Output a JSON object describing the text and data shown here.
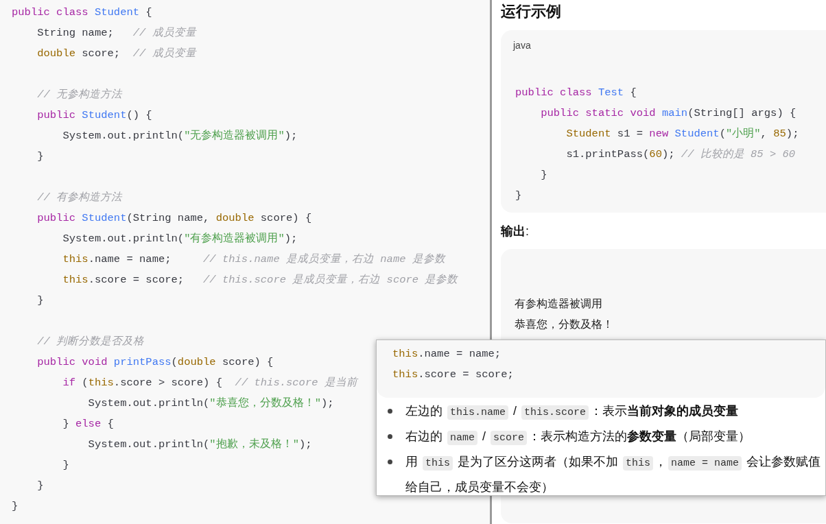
{
  "source_code": {
    "lines": [
      {
        "kind": "code",
        "tokens": [
          {
            "kind": "kw",
            "text": "public class "
          },
          {
            "kind": "cls",
            "text": "Student"
          },
          {
            "kind": "plain",
            "text": " {"
          }
        ]
      },
      {
        "kind": "code",
        "tokens": [
          {
            "kind": "plain",
            "text": "    String name;   "
          },
          {
            "kind": "cmt",
            "text": "// 成员变量"
          }
        ]
      },
      {
        "kind": "code",
        "tokens": [
          {
            "kind": "type",
            "text": "    double"
          },
          {
            "kind": "plain",
            "text": " score;  "
          },
          {
            "kind": "cmt",
            "text": "// 成员变量"
          }
        ]
      },
      {
        "kind": "blank"
      },
      {
        "kind": "code",
        "tokens": [
          {
            "kind": "cmt",
            "text": "    // 无参构造方法"
          }
        ]
      },
      {
        "kind": "code",
        "tokens": [
          {
            "kind": "kw",
            "text": "    public "
          },
          {
            "kind": "cls",
            "text": "Student"
          },
          {
            "kind": "plain",
            "text": "() {"
          }
        ]
      },
      {
        "kind": "code",
        "tokens": [
          {
            "kind": "plain",
            "text": "        System.out.println("
          },
          {
            "kind": "str",
            "text": "\"无参构造器被调用\""
          },
          {
            "kind": "plain",
            "text": ");"
          }
        ]
      },
      {
        "kind": "code",
        "tokens": [
          {
            "kind": "plain",
            "text": "    }"
          }
        ]
      },
      {
        "kind": "blank"
      },
      {
        "kind": "code",
        "tokens": [
          {
            "kind": "cmt",
            "text": "    // 有参构造方法"
          }
        ]
      },
      {
        "kind": "code",
        "tokens": [
          {
            "kind": "kw",
            "text": "    public "
          },
          {
            "kind": "cls",
            "text": "Student"
          },
          {
            "kind": "plain",
            "text": "(String name, "
          },
          {
            "kind": "type",
            "text": "double"
          },
          {
            "kind": "plain",
            "text": " score) {"
          }
        ]
      },
      {
        "kind": "code",
        "tokens": [
          {
            "kind": "plain",
            "text": "        System.out.println("
          },
          {
            "kind": "str",
            "text": "\"有参构造器被调用\""
          },
          {
            "kind": "plain",
            "text": ");"
          }
        ]
      },
      {
        "kind": "code",
        "tokens": [
          {
            "kind": "type",
            "text": "        this"
          },
          {
            "kind": "plain",
            "text": ".name = name;     "
          },
          {
            "kind": "cmt",
            "text": "// this.name 是成员变量，右边 name 是参数"
          }
        ]
      },
      {
        "kind": "code",
        "tokens": [
          {
            "kind": "type",
            "text": "        this"
          },
          {
            "kind": "plain",
            "text": ".score = score;   "
          },
          {
            "kind": "cmt",
            "text": "// this.score 是成员变量，右边 score 是参数"
          }
        ]
      },
      {
        "kind": "code",
        "tokens": [
          {
            "kind": "plain",
            "text": "    }"
          }
        ]
      },
      {
        "kind": "blank"
      },
      {
        "kind": "code",
        "tokens": [
          {
            "kind": "cmt",
            "text": "    // 判断分数是否及格"
          }
        ]
      },
      {
        "kind": "code",
        "tokens": [
          {
            "kind": "kw",
            "text": "    public void "
          },
          {
            "kind": "cls",
            "text": "printPass"
          },
          {
            "kind": "plain",
            "text": "("
          },
          {
            "kind": "type",
            "text": "double"
          },
          {
            "kind": "plain",
            "text": " score) {"
          }
        ]
      },
      {
        "kind": "code",
        "tokens": [
          {
            "kind": "kw",
            "text": "        if"
          },
          {
            "kind": "plain",
            "text": " ("
          },
          {
            "kind": "type",
            "text": "this"
          },
          {
            "kind": "plain",
            "text": ".score > score) {  "
          },
          {
            "kind": "cmt",
            "text": "// this.score 是当前"
          }
        ]
      },
      {
        "kind": "code",
        "tokens": [
          {
            "kind": "plain",
            "text": "            System.out.println("
          },
          {
            "kind": "str",
            "text": "\"恭喜您，分数及格！\""
          },
          {
            "kind": "plain",
            "text": ");"
          }
        ]
      },
      {
        "kind": "code",
        "tokens": [
          {
            "kind": "plain",
            "text": "        } "
          },
          {
            "kind": "kw",
            "text": "else"
          },
          {
            "kind": "plain",
            "text": " {"
          }
        ]
      },
      {
        "kind": "code",
        "tokens": [
          {
            "kind": "plain",
            "text": "            System.out.println("
          },
          {
            "kind": "str",
            "text": "\"抱歉，未及格！\""
          },
          {
            "kind": "plain",
            "text": ");"
          }
        ]
      },
      {
        "kind": "code",
        "tokens": [
          {
            "kind": "plain",
            "text": "        }"
          }
        ]
      },
      {
        "kind": "code",
        "tokens": [
          {
            "kind": "plain",
            "text": "    }"
          }
        ]
      },
      {
        "kind": "code",
        "tokens": [
          {
            "kind": "plain",
            "text": "}"
          }
        ]
      }
    ]
  },
  "answer": {
    "heading": "运行示例",
    "example_code": {
      "language": "java",
      "lines": [
        {
          "kind": "blank"
        },
        {
          "kind": "code",
          "tokens": [
            {
              "kind": "kw",
              "text": "public class "
            },
            {
              "kind": "cls",
              "text": "Test"
            },
            {
              "kind": "plain",
              "text": " {"
            }
          ]
        },
        {
          "kind": "code",
          "tokens": [
            {
              "kind": "kw",
              "text": "    public static void "
            },
            {
              "kind": "cls",
              "text": "main"
            },
            {
              "kind": "plain",
              "text": "(String[] args) {"
            }
          ]
        },
        {
          "kind": "code",
          "tokens": [
            {
              "kind": "type",
              "text": "        Student"
            },
            {
              "kind": "plain",
              "text": " s1 = "
            },
            {
              "kind": "kw",
              "text": "new "
            },
            {
              "kind": "cls",
              "text": "Student"
            },
            {
              "kind": "plain",
              "text": "("
            },
            {
              "kind": "str",
              "text": "\"小明\""
            },
            {
              "kind": "plain",
              "text": ", "
            },
            {
              "kind": "num",
              "text": "85"
            },
            {
              "kind": "plain",
              "text": ");"
            }
          ]
        },
        {
          "kind": "code",
          "tokens": [
            {
              "kind": "plain",
              "text": "        s1.printPass("
            },
            {
              "kind": "num",
              "text": "60"
            },
            {
              "kind": "plain",
              "text": "); "
            },
            {
              "kind": "cmt",
              "text": "// 比较的是 85 > 60"
            }
          ]
        },
        {
          "kind": "code",
          "tokens": [
            {
              "kind": "plain",
              "text": "    }"
            }
          ]
        },
        {
          "kind": "code",
          "tokens": [
            {
              "kind": "plain",
              "text": "}"
            }
          ]
        }
      ]
    },
    "output_label": "**输出**:",
    "output_lines": [
      "有参构造器被调用",
      "恭喜您，分数及格！"
    ]
  },
  "popup": {
    "code_lines": [
      {
        "kind": "code",
        "tokens": [
          {
            "kind": "type",
            "text": "this"
          },
          {
            "kind": "plain",
            "text": ".name = name;"
          }
        ]
      },
      {
        "kind": "code",
        "tokens": [
          {
            "kind": "type",
            "text": "this"
          },
          {
            "kind": "plain",
            "text": ".score = score;"
          }
        ]
      }
    ],
    "bullets": [
      [
        {
          "kind": "text",
          "text": "左边的 "
        },
        {
          "kind": "code",
          "text": "this.name"
        },
        {
          "kind": "text",
          "text": " / "
        },
        {
          "kind": "code",
          "text": "this.score"
        },
        {
          "kind": "text",
          "text": "：表示"
        },
        {
          "kind": "bold",
          "text": "当前对象的成员变量"
        }
      ],
      [
        {
          "kind": "text",
          "text": "右边的 "
        },
        {
          "kind": "code",
          "text": "name"
        },
        {
          "kind": "text",
          "text": " / "
        },
        {
          "kind": "code",
          "text": "score"
        },
        {
          "kind": "text",
          "text": "：表示构造方法的"
        },
        {
          "kind": "bold",
          "text": "参数变量"
        },
        {
          "kind": "text",
          "text": "（局部变量）"
        }
      ],
      [
        {
          "kind": "text",
          "text": "用 "
        },
        {
          "kind": "code",
          "text": "this"
        },
        {
          "kind": "text",
          "text": " 是为了区分这两者（如果不加 "
        },
        {
          "kind": "code",
          "text": "this"
        },
        {
          "kind": "text",
          "text": "，"
        },
        {
          "kind": "code",
          "text": "name = name"
        },
        {
          "kind": "text",
          "text": " 会让参数赋值给自己，成员变量不会变）"
        }
      ]
    ]
  }
}
